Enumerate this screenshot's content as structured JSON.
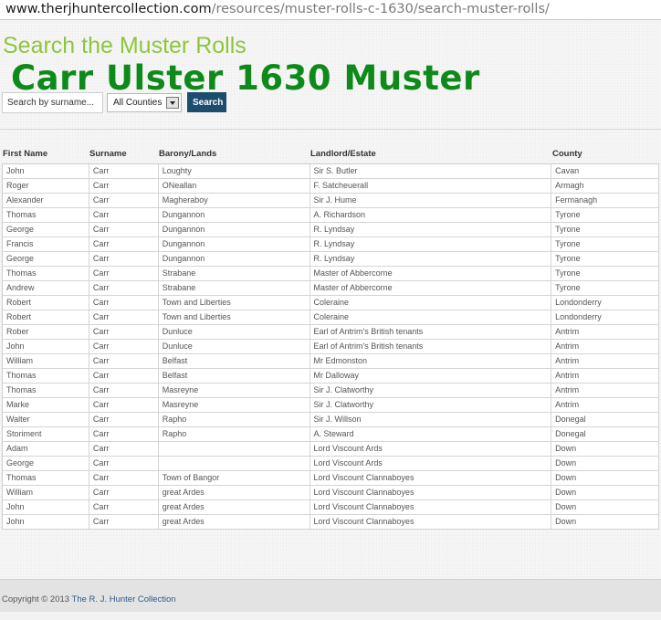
{
  "address_bar": {
    "host": "www.therjhuntercollection.com",
    "path": "/resources/muster-rolls-c-1630/search-muster-rolls/"
  },
  "page": {
    "section_title": "Search the Muster Rolls",
    "muster_title": "Carr Ulster 1630 Muster"
  },
  "search": {
    "placeholder": "Search by surname...",
    "county_selected": "All Counties",
    "button_label": "Search"
  },
  "table": {
    "headers": [
      "First Name",
      "Surname",
      "Barony/Lands",
      "Landlord/Estate",
      "County"
    ],
    "rows": [
      [
        "John",
        "Carr",
        "Loughty",
        "Sir S. Butler",
        "Cavan"
      ],
      [
        "Roger",
        "Carr",
        "ONeallan",
        "F. Satcheuerall",
        "Armagh"
      ],
      [
        "Alexander",
        "Carr",
        "Magheraboy",
        "Sir J. Hume",
        "Fermanagh"
      ],
      [
        "Thomas",
        "Carr",
        "Dungannon",
        "A. Richardson",
        "Tyrone"
      ],
      [
        "George",
        "Carr",
        "Dungannon",
        "R. Lyndsay",
        "Tyrone"
      ],
      [
        "Francis",
        "Carr",
        "Dungannon",
        "R. Lyndsay",
        "Tyrone"
      ],
      [
        "George",
        "Carr",
        "Dungannon",
        "R. Lyndsay",
        "Tyrone"
      ],
      [
        "Thomas",
        "Carr",
        "Strabane",
        "Master of Abbercorne",
        "Tyrone"
      ],
      [
        "Andrew",
        "Carr",
        "Strabane",
        "Master of Abbercorne",
        "Tyrone"
      ],
      [
        "Robert",
        "Carr",
        "Town and Liberties",
        "Coleraine",
        "Londonderry"
      ],
      [
        "Robert",
        "Carr",
        "Town and Liberties",
        "Coleraine",
        "Londonderry"
      ],
      [
        "Rober",
        "Carr",
        "Dunluce",
        "Earl of Antrim's British tenants",
        "Antrim"
      ],
      [
        "John",
        "Carr",
        "Dunluce",
        "Earl of Antrim's British tenants",
        "Antrim"
      ],
      [
        "William",
        "Carr",
        "Belfast",
        "Mr Edmonston",
        "Antrim"
      ],
      [
        "Thomas",
        "Carr",
        "Belfast",
        "Mr Dalloway",
        "Antrim"
      ],
      [
        "Thomas",
        "Carr",
        "Masreyne",
        "Sir J. Clatworthy",
        "Antrim"
      ],
      [
        "Marke",
        "Carr",
        "Masreyne",
        "Sir J. Clatworthy",
        "Antrim"
      ],
      [
        "Walter",
        "Carr",
        "Rapho",
        "Sir J. Willson",
        "Donegal"
      ],
      [
        "Storiment",
        "Carr",
        "Rapho",
        "A. Steward",
        "Donegal"
      ],
      [
        "Adam",
        "Carr",
        "",
        "Lord Viscount Ards",
        "Down"
      ],
      [
        "George",
        "Carr",
        "",
        "Lord Viscount Ards",
        "Down"
      ],
      [
        "Thomas",
        "Carr",
        "Town of Bangor",
        "Lord Viscount Clannaboyes",
        "Down"
      ],
      [
        "William",
        "Carr",
        "great Ardes",
        "Lord Viscount Clannaboyes",
        "Down"
      ],
      [
        "John",
        "Carr",
        "great Ardes",
        "Lord Viscount Clannaboyes",
        "Down"
      ],
      [
        "John",
        "Carr",
        "great Ardes",
        "Lord Viscount Clannaboyes",
        "Down"
      ]
    ]
  },
  "footer": {
    "copyright": "Copyright © 2013 ",
    "link_text": "The R. J. Hunter Collection"
  },
  "colors": {
    "section_title": "#8dc63f",
    "muster_title": "#0e8a1a",
    "search_button": "#1d4d6e"
  }
}
